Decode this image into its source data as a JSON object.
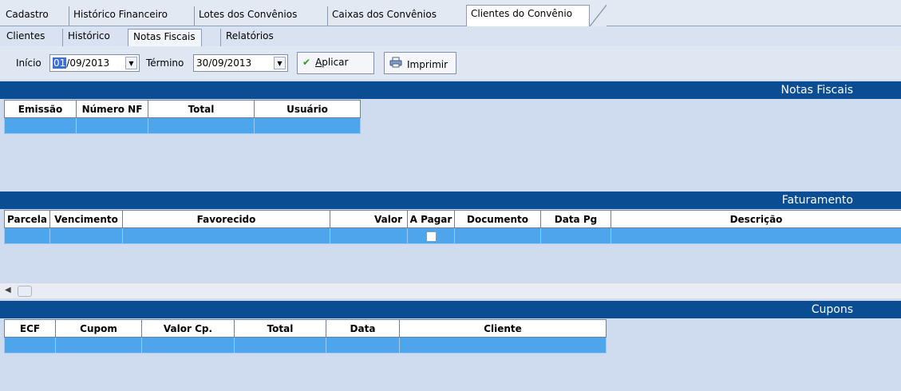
{
  "top_tabs": [
    "Cadastro",
    "Histórico Financeiro",
    "Lotes dos Convênios",
    "Caixas dos Convênios",
    "Clientes do Convênio"
  ],
  "sub_tabs": [
    "Clientes",
    "Histórico",
    "Notas Fiscais",
    "Relatórios"
  ],
  "filter": {
    "start_label": "Início",
    "start_day": "01",
    "start_rest": "/09/2013",
    "end_label": "Término",
    "end_value": "30/09/2013",
    "apply_label": "Aplicar",
    "apply_mnemonic": "A",
    "apply_rest": "plicar",
    "print_label": "Imprimir"
  },
  "sections": {
    "notas": {
      "title": "Notas Fiscais",
      "columns": [
        "Emissão",
        "Número NF",
        "Total",
        "Usuário"
      ]
    },
    "faturamento": {
      "title": "Faturamento",
      "columns": [
        "Parcela",
        "Vencimento",
        "Favorecido",
        "Valor",
        "A Pagar",
        "Documento",
        "Data Pg",
        "Descrição"
      ]
    },
    "cupons": {
      "title": "Cupons",
      "columns": [
        "ECF",
        "Cupom",
        "Valor Cp.",
        "Total",
        "Data",
        "Cliente"
      ]
    }
  },
  "colors": {
    "section_bar": "#0b4d92",
    "selected_row": "#4da5ec",
    "background": "#cfdcef"
  },
  "icons": {
    "apply": "check-icon",
    "print": "printer-icon",
    "dropdown": "chevron-down-icon",
    "scroll_left": "arrow-left-icon"
  }
}
